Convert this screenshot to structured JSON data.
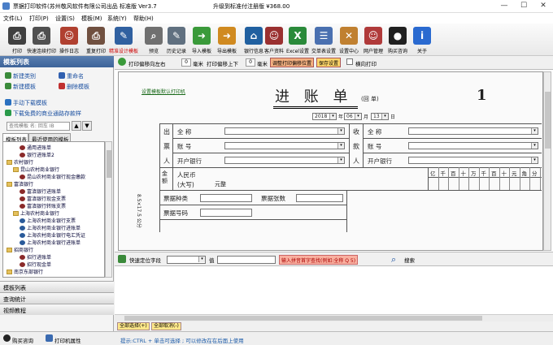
{
  "window": {
    "title": "票据打印软件(苏州敬风软件有限公司出品 标准版 Ver3.7",
    "registration": "升级到标准付注册版 ¥368.00",
    "min": "—",
    "max": "☐",
    "close": "✕"
  },
  "menu": [
    "文件(L)",
    "打印(P)",
    "设置(S)",
    "模板(M)",
    "系统(Y)",
    "帮助(H)"
  ],
  "toolbar": [
    {
      "label": "打印",
      "icon": "printer-icon",
      "color": "#404040",
      "glyph": "⎙"
    },
    {
      "label": "快速连续打印",
      "icon": "multi-printer-icon",
      "color": "#505050",
      "glyph": "⎙"
    },
    {
      "label": "操作日志",
      "icon": "person-log-icon",
      "color": "#b04030",
      "glyph": "☺"
    },
    {
      "label": "重复打印",
      "icon": "repeat-print-icon",
      "color": "#705040",
      "glyph": "⎙"
    },
    {
      "label": "精准设计模板",
      "icon": "design-pen-icon",
      "color": "#3060a0",
      "glyph": "✎",
      "red": true
    },
    {
      "label": "预览",
      "icon": "preview-magnifier-icon",
      "color": "#707070",
      "glyph": "⌕"
    },
    {
      "label": "历史记录",
      "icon": "history-edit-icon",
      "color": "#607080",
      "glyph": "✎"
    },
    {
      "label": "导入模板",
      "icon": "import-arrow-icon",
      "color": "#3a9a3a",
      "glyph": "➜"
    },
    {
      "label": "导出模板",
      "icon": "export-arrow-icon",
      "color": "#d08a20",
      "glyph": "➜"
    },
    {
      "label": "银行信息",
      "icon": "bank-icon",
      "color": "#2060a0",
      "glyph": "⌂"
    },
    {
      "label": "客户资料",
      "icon": "customer-icon",
      "color": "#9a3030",
      "glyph": "☺"
    },
    {
      "label": "Excel设置",
      "icon": "excel-icon",
      "color": "#2a8a3a",
      "glyph": "X"
    },
    {
      "label": "交单表设置",
      "icon": "form-settings-icon",
      "color": "#4a70b0",
      "glyph": "☰"
    },
    {
      "label": "设置中心",
      "icon": "settings-tools-icon",
      "color": "#c08030",
      "glyph": "✕"
    },
    {
      "label": "网户管理",
      "icon": "user-manage-icon",
      "color": "#b03a3a",
      "glyph": "☺"
    },
    {
      "label": "购买咨询",
      "icon": "qq-penguin-icon",
      "color": "#202020",
      "glyph": "●"
    },
    {
      "label": "关于",
      "icon": "info-icon",
      "color": "#2a6ad0",
      "glyph": "i"
    }
  ],
  "left": {
    "title": "模板列表",
    "new_category": "新建类别",
    "rename": "重命名",
    "new_template": "新建模板",
    "delete_template": "删除模板",
    "manual_download": "手动下载模板",
    "free_download": "下载免费的商业通路存款样",
    "search_placeholder": "查找模板 名: 回车 IB",
    "tab_list": "模板列表",
    "tab_recent": "最近使用的模板",
    "tree": [
      {
        "t": "通用进账单",
        "i": "doc",
        "lv": 2
      },
      {
        "t": "银行进账单2",
        "i": "doc",
        "lv": 2
      },
      {
        "t": "农村银行",
        "i": "folder",
        "lv": 0
      },
      {
        "t": "昆山农村商业银行",
        "i": "folder",
        "lv": 1
      },
      {
        "t": "昆山农村商业银行现金缴款",
        "i": "doc",
        "lv": 2
      },
      {
        "t": "富滇银行",
        "i": "folder",
        "lv": 0
      },
      {
        "t": "富滇银行进账单",
        "i": "doc",
        "lv": 2
      },
      {
        "t": "富滇银行现金支票",
        "i": "doc",
        "lv": 2
      },
      {
        "t": "富滇银行转账支票",
        "i": "doc",
        "lv": 2
      },
      {
        "t": "上海农村商业银行",
        "i": "folder",
        "lv": 1
      },
      {
        "t": "上海农村商业银行支票",
        "i": "doc2",
        "lv": 2
      },
      {
        "t": "上海农村商业银行进账单",
        "i": "doc2",
        "lv": 2
      },
      {
        "t": "上海农村商业银行电汇凭证",
        "i": "doc2",
        "lv": 2
      },
      {
        "t": "上海农村商业银行进账单",
        "i": "doc2",
        "lv": 2
      },
      {
        "t": "招商银行",
        "i": "folder",
        "lv": 0
      },
      {
        "t": "招行进账单",
        "i": "doc",
        "lv": 2
      },
      {
        "t": "招行现金单",
        "i": "doc",
        "lv": 2
      },
      {
        "t": "南京东部银行",
        "i": "folder",
        "lv": 0
      }
    ],
    "nav": [
      "模板列表",
      "查询统计",
      "视频教程"
    ]
  },
  "options": {
    "lr_label": "打印偏移向左右",
    "lr_value": "0",
    "lr_unit": "毫米",
    "ud_label": "打印偏移上下",
    "ud_value": "0",
    "ud_unit": "毫米",
    "adjust_btn": "调整打印偏移位置",
    "save_btn": "保存设置",
    "landscape": "横向打印"
  },
  "form": {
    "hint_link": "设置模板默认打印机",
    "title": "进 账 单",
    "title_suffix": "(回 单)",
    "number": "1",
    "year": "2018",
    "year_unit": "年",
    "month": "06",
    "month_unit": "月",
    "day": "13",
    "day_unit": "日",
    "payer_group": [
      "出",
      "票",
      "人"
    ],
    "payee_group": [
      "收",
      "款",
      "人"
    ],
    "payer_name": "全  称",
    "payer_acct": "账  号",
    "payer_bank": "开户银行",
    "payee_name": "全  称",
    "payee_acct": "账  号",
    "payee_bank": "开户银行",
    "amount_label": "金额",
    "rmb": "人民币",
    "capital": "(大写)",
    "capital_value": "元整",
    "digits": [
      "亿",
      "千",
      "百",
      "十",
      "万",
      "千",
      "百",
      "十",
      "元",
      "角",
      "分"
    ],
    "bill_type": "票据种类",
    "bill_count": "票据张数",
    "bill_no": "票据号码",
    "side_text": "8.5×17.5 公分"
  },
  "fieldbar": {
    "label": "快速定位字段",
    "value_label": "值",
    "hint": "输入拼音首字查找(例如:全称 Q 5)",
    "search": "搜索"
  },
  "select": {
    "all": "全部选择(+)",
    "none": "全部取消(-)"
  },
  "status": {
    "support": "购买咨询",
    "online": "打印机属性",
    "tip": "提示:CTRL + 单击可选择 ; 可以修改在在后面上使用"
  }
}
